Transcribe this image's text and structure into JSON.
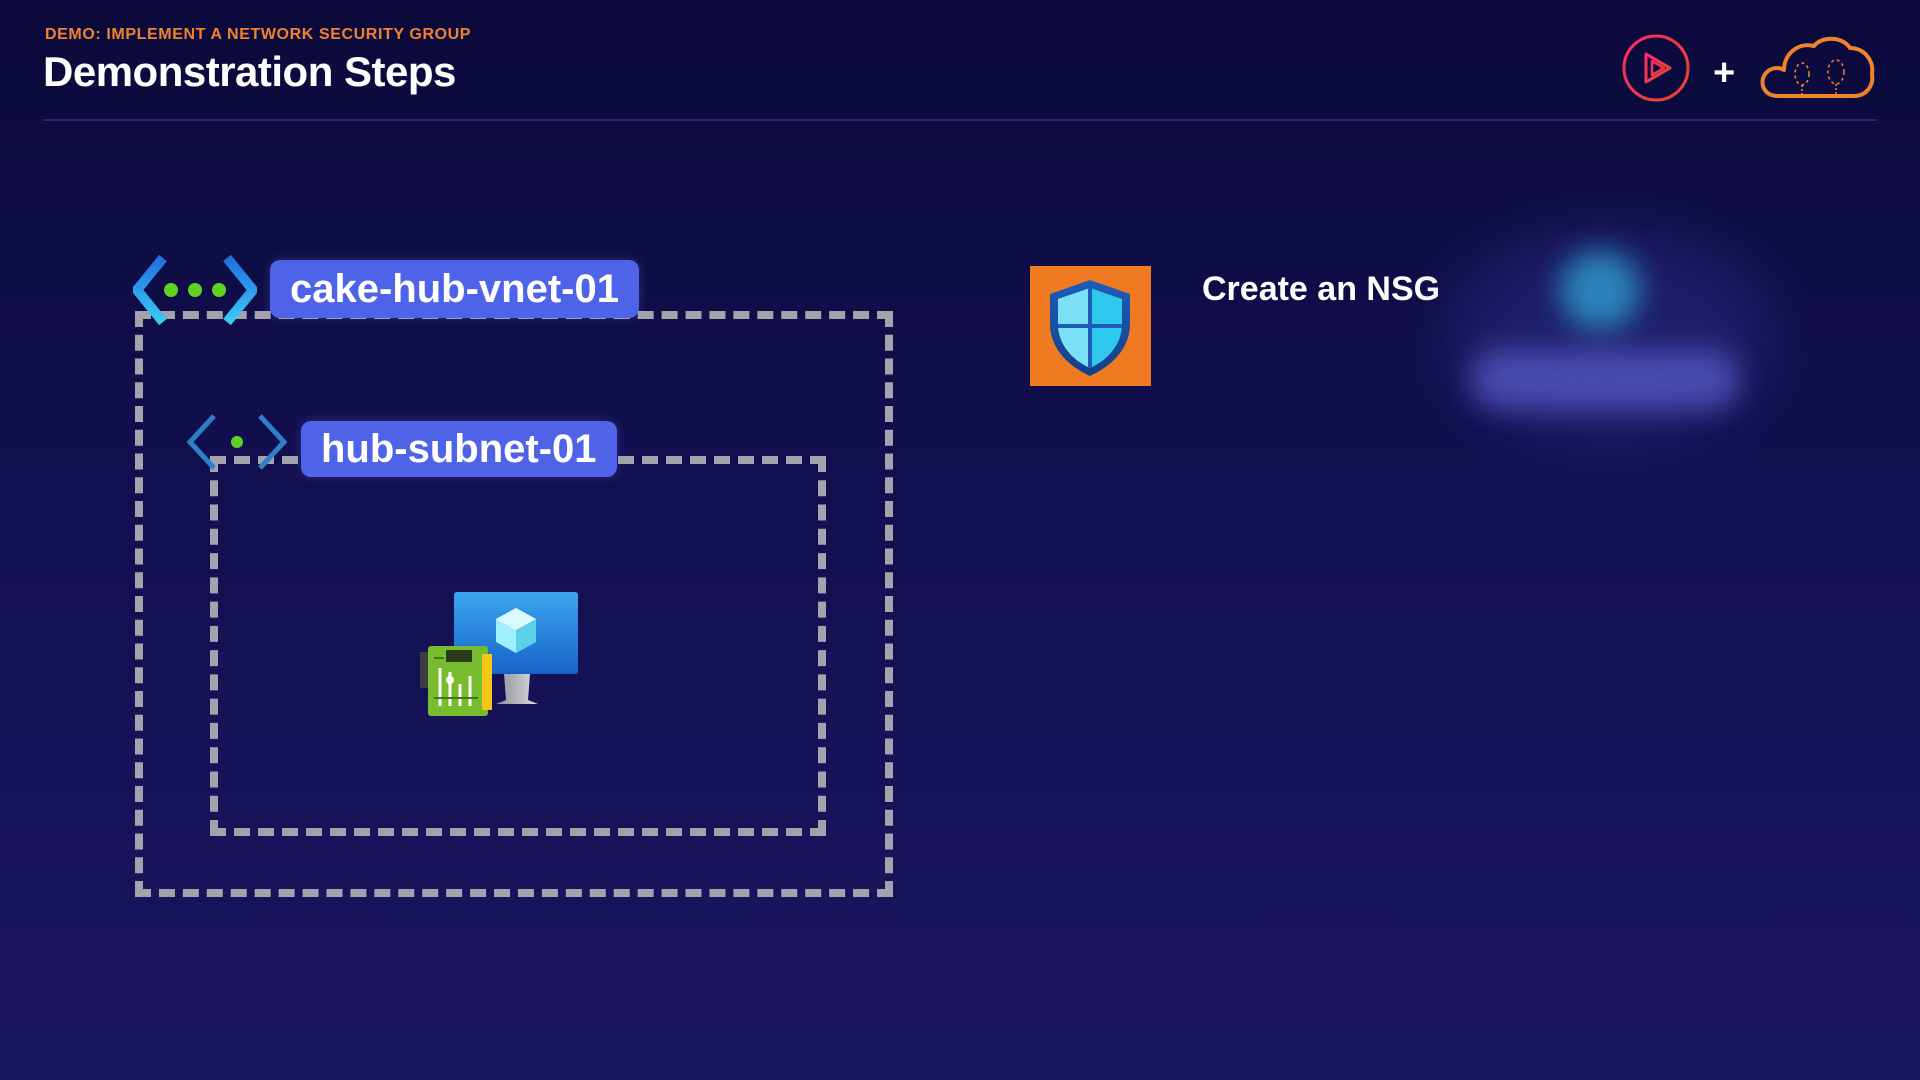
{
  "header": {
    "eyebrow": "DEMO: IMPLEMENT A NETWORK SECURITY GROUP",
    "title": "Demonstration Steps",
    "plus": "+"
  },
  "diagram": {
    "vnet_label": "cake-hub-vnet-01",
    "subnet_label": "hub-subnet-01"
  },
  "steps": [
    {
      "label": "Create an NSG"
    }
  ],
  "icons": {
    "vnet": "virtual-network-icon",
    "subnet": "subnet-icon",
    "vm": "virtual-machine-icon",
    "nic": "network-interface-icon",
    "nsg": "network-security-group-icon",
    "brand_left": "pluralsight-logo",
    "brand_right": "cloud-logo"
  },
  "colors": {
    "accent_orange": "#f0822f",
    "label_blue": "#4f63e8",
    "nsg_tile": "#ef7a21",
    "dash": "#a3a3ad"
  }
}
